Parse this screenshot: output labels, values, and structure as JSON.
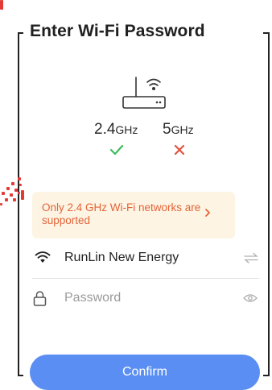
{
  "title": "Enter Wi-Fi Password",
  "bands": {
    "band_24": {
      "value": "2.4",
      "unit": "GHz",
      "status_icon": "check-icon",
      "color": "#3dbb5c"
    },
    "band_5": {
      "value": "5",
      "unit": "GHz",
      "status_icon": "cross-icon",
      "color": "#e0533f"
    }
  },
  "notice": {
    "text": "Only 2.4 GHz Wi-Fi networks are supported",
    "icon": "chevron-right-icon"
  },
  "network": {
    "name": "RunLin New Energy",
    "icon": "wifi-icon",
    "switch_icon": "switch-network-icon"
  },
  "password": {
    "placeholder": "Password",
    "value": "",
    "lock_icon": "lock-icon",
    "visibility_icon": "eye-icon"
  },
  "confirm_label": "Confirm",
  "colors": {
    "accent": "#5b8ef2",
    "notice_bg": "#fdf4e3",
    "notice_text": "#e4643a"
  }
}
